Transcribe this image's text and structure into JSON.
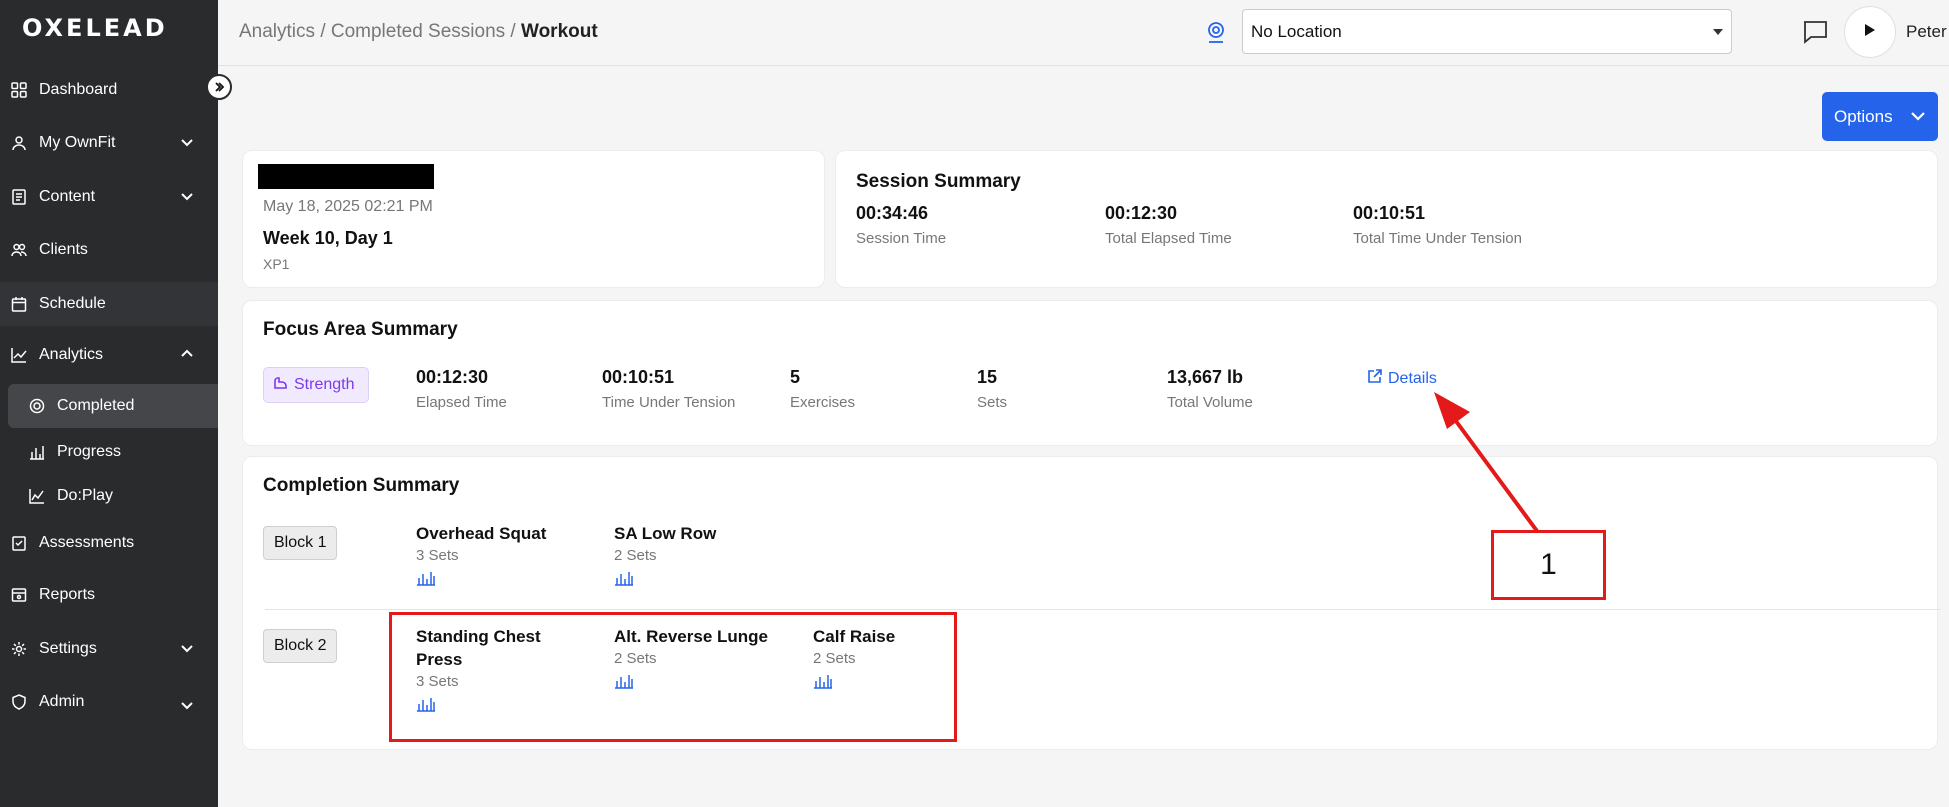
{
  "app": {
    "logo": "OXELEAD",
    "user": "Peter"
  },
  "sidebar": {
    "items": [
      {
        "label": "Dashboard",
        "icon": "dashboard-icon"
      },
      {
        "label": "My OwnFit",
        "icon": "person-icon"
      },
      {
        "label": "Content",
        "icon": "document-icon"
      },
      {
        "label": "Clients",
        "icon": "people-icon"
      },
      {
        "label": "Schedule",
        "icon": "calendar-icon"
      },
      {
        "label": "Analytics",
        "icon": "chart-icon"
      },
      {
        "label": "Completed",
        "icon": "target-icon"
      },
      {
        "label": "Progress",
        "icon": "bar-chart-icon"
      },
      {
        "label": "Do:Play",
        "icon": "line-chart-icon"
      },
      {
        "label": "Assessments",
        "icon": "clipboard-icon"
      },
      {
        "label": "Reports",
        "icon": "report-icon"
      },
      {
        "label": "Settings",
        "icon": "gear-icon"
      },
      {
        "label": "Admin",
        "icon": "shield-icon"
      }
    ]
  },
  "header": {
    "breadcrumb": [
      "Analytics",
      "Completed Sessions",
      "Workout"
    ],
    "location_value": "No Location"
  },
  "options_label": "Options",
  "session_info": {
    "date": "May 18, 2025 02:21 PM",
    "week": "Week 10, Day 1",
    "program": "XP1"
  },
  "session_summary": {
    "title": "Session Summary",
    "stats": [
      {
        "value": "00:34:46",
        "label": "Session Time"
      },
      {
        "value": "00:12:30",
        "label": "Total Elapsed Time"
      },
      {
        "value": "00:10:51",
        "label": "Total Time Under Tension"
      }
    ]
  },
  "focus_area": {
    "title": "Focus Area Summary",
    "badge": "Strength",
    "stats": [
      {
        "value": "00:12:30",
        "label": "Elapsed Time"
      },
      {
        "value": "00:10:51",
        "label": "Time Under Tension"
      },
      {
        "value": "5",
        "label": "Exercises"
      },
      {
        "value": "15",
        "label": "Sets"
      },
      {
        "value": "13,667 lb",
        "label": "Total Volume"
      }
    ],
    "details_label": "Details"
  },
  "completion": {
    "title": "Completion Summary",
    "blocks": [
      {
        "label": "Block 1",
        "exercises": [
          {
            "name": "Overhead Squat",
            "sets": "3 Sets"
          },
          {
            "name": "SA Low Row",
            "sets": "2 Sets"
          }
        ]
      },
      {
        "label": "Block 2",
        "exercises": [
          {
            "name": "Standing Chest Press",
            "sets": "3 Sets"
          },
          {
            "name": "Alt. Reverse Lunge",
            "sets": "2 Sets"
          },
          {
            "name": "Calf Raise",
            "sets": "2 Sets"
          }
        ]
      }
    ]
  },
  "annotation": {
    "label": "1",
    "color": "#e3191a"
  },
  "colors": {
    "accent": "#2563eb",
    "strength": "#7c3aed",
    "sidebar": "#2a2b2d"
  }
}
